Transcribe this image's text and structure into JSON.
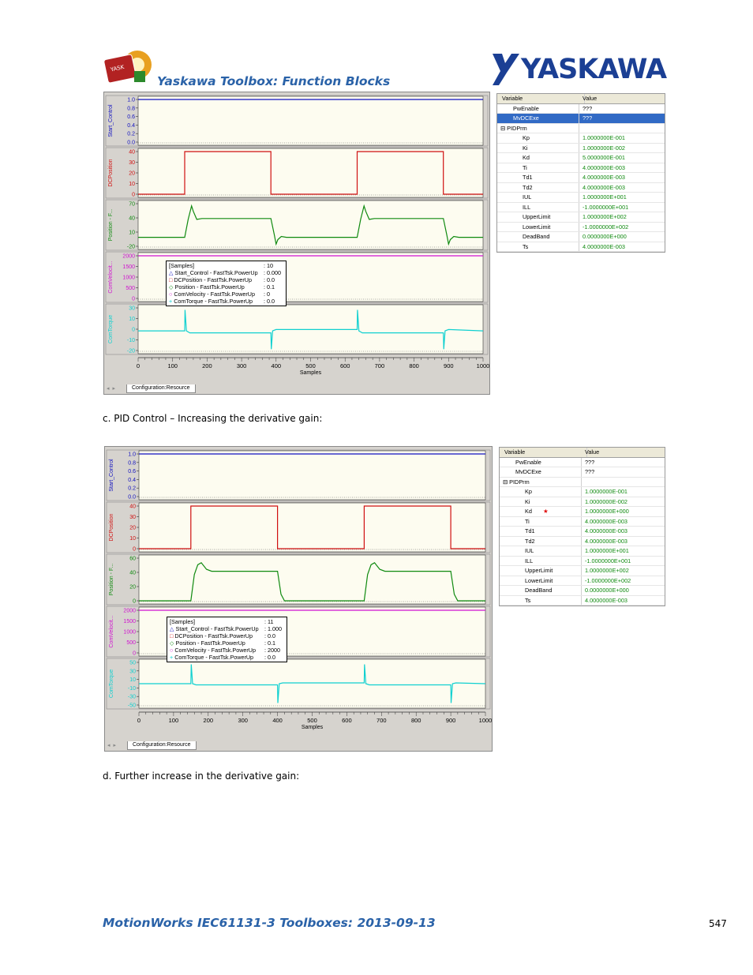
{
  "header": {
    "title": "Yaskawa Toolbox: Function Blocks",
    "brand": "YASKAWA",
    "logo_icon": "yaskawa-toolbox-logo"
  },
  "figures": [
    {
      "tab_label": "Configuration:Resource",
      "legend": {
        "title": "[Samples]",
        "title_value": ": 10",
        "rows": [
          {
            "label": "Start_Control - FastTsk.PowerUp",
            "value": ": 0.000",
            "color": "#1010c0",
            "marker": "triangle"
          },
          {
            "label": "DCPosition - FastTsk.PowerUp",
            "value": ": 0.0",
            "color": "#d01010",
            "marker": "square"
          },
          {
            "label": "Position - FastTsk.PowerUp",
            "value": ": 0.1",
            "color": "#108a10",
            "marker": "diamond"
          },
          {
            "label": "ComVelocity - FastTsk.PowerUp",
            "value": ": 0",
            "color": "#d010d0",
            "marker": "circle"
          },
          {
            "label": "ComTorque - FastTsk.PowerUp",
            "value": ": 0.0",
            "color": "#10d0d0",
            "marker": "plus"
          }
        ]
      },
      "variables": {
        "header": [
          "Variable",
          "Value"
        ],
        "rows": [
          {
            "name": "PwEnable",
            "value": "???",
            "indent": 1,
            "selected": false,
            "green": false
          },
          {
            "name": "MvDCExe",
            "value": "???",
            "indent": 1,
            "selected": true,
            "green": false
          },
          {
            "name": "PIDPrm",
            "value": "",
            "indent": 0,
            "expander": "⊟",
            "selected": false,
            "green": false
          },
          {
            "name": "Kp",
            "value": "1.0000000E-001",
            "indent": 2,
            "green": true
          },
          {
            "name": "Ki",
            "value": "1.0000000E-002",
            "indent": 2,
            "green": true
          },
          {
            "name": "Kd",
            "value": "5.0000000E-001",
            "indent": 2,
            "green": true
          },
          {
            "name": "Ti",
            "value": "4.0000000E-003",
            "indent": 2,
            "green": true
          },
          {
            "name": "Td1",
            "value": "4.0000000E-003",
            "indent": 2,
            "green": true
          },
          {
            "name": "Td2",
            "value": "4.0000000E-003",
            "indent": 2,
            "green": true
          },
          {
            "name": "IUL",
            "value": "1.0000000E+001",
            "indent": 2,
            "green": true
          },
          {
            "name": "ILL",
            "value": "-1.0000000E+001",
            "indent": 2,
            "green": true
          },
          {
            "name": "UpperLimit",
            "value": "1.0000000E+002",
            "indent": 2,
            "green": true
          },
          {
            "name": "LowerLimit",
            "value": "-1.0000000E+002",
            "indent": 2,
            "green": true
          },
          {
            "name": "DeadBand",
            "value": "0.0000000E+000",
            "indent": 2,
            "green": true
          },
          {
            "name": "Ts",
            "value": "4.0000000E-003",
            "indent": 2,
            "green": true
          }
        ]
      }
    },
    {
      "tab_label": "Configuration:Resource",
      "legend": {
        "title": "[Samples]",
        "title_value": ": 11",
        "rows": [
          {
            "label": "Start_Control - FastTsk.PowerUp",
            "value": ": 1.000",
            "color": "#1010c0",
            "marker": "triangle"
          },
          {
            "label": "DCPosition - FastTsk.PowerUp",
            "value": ": 0.0",
            "color": "#d01010",
            "marker": "square"
          },
          {
            "label": "Position - FastTsk.PowerUp",
            "value": ": 0.1",
            "color": "#108a10",
            "marker": "diamond"
          },
          {
            "label": "ComVelocity - FastTsk.PowerUp",
            "value": ": 2000",
            "color": "#d010d0",
            "marker": "circle"
          },
          {
            "label": "ComTorque - FastTsk.PowerUp",
            "value": ": 0.0",
            "color": "#10d0d0",
            "marker": "plus"
          }
        ]
      },
      "variables": {
        "header": [
          "Variable",
          "Value"
        ],
        "rows": [
          {
            "name": "PwEnable",
            "value": "???",
            "indent": 1,
            "selected": false,
            "green": false
          },
          {
            "name": "MvDCExe",
            "value": "???",
            "indent": 1,
            "selected": false,
            "green": false
          },
          {
            "name": "PIDPrm",
            "value": "",
            "indent": 0,
            "expander": "⊟",
            "selected": false,
            "green": false
          },
          {
            "name": "Kp",
            "value": "1.0000000E-001",
            "indent": 2,
            "green": true
          },
          {
            "name": "Ki",
            "value": "1.0000000E-002",
            "indent": 2,
            "green": true
          },
          {
            "name": "Kd",
            "value": "1.0000000E+000",
            "indent": 2,
            "green": true,
            "star": "★"
          },
          {
            "name": "Ti",
            "value": "4.0000000E-003",
            "indent": 2,
            "green": true
          },
          {
            "name": "Td1",
            "value": "4.0000000E-003",
            "indent": 2,
            "green": true
          },
          {
            "name": "Td2",
            "value": "4.0000000E-003",
            "indent": 2,
            "green": true
          },
          {
            "name": "IUL",
            "value": "1.0000000E+001",
            "indent": 2,
            "green": true
          },
          {
            "name": "ILL",
            "value": "-1.0000000E+001",
            "indent": 2,
            "green": true
          },
          {
            "name": "UpperLimit",
            "value": "1.0000000E+002",
            "indent": 2,
            "green": true
          },
          {
            "name": "LowerLimit",
            "value": "-1.0000000E+002",
            "indent": 2,
            "green": true
          },
          {
            "name": "DeadBand",
            "value": "0.0000000E+000",
            "indent": 2,
            "green": true
          },
          {
            "name": "Ts",
            "value": "4.0000000E-003",
            "indent": 2,
            "green": true
          }
        ]
      }
    }
  ],
  "chart_data": [
    {
      "type": "line",
      "xlabel": "Samples",
      "xlim": [
        0,
        1000
      ],
      "xticks": [
        0,
        100,
        200,
        300,
        400,
        500,
        600,
        700,
        800,
        900,
        1000
      ],
      "panels": [
        {
          "ylabel": "Start_Control",
          "color": "#1010c0",
          "yticks": [
            "1.0",
            "0.8",
            "0.6",
            "0.4",
            "0.2",
            "0.0"
          ],
          "ylim": [
            0,
            1
          ],
          "x": [
            0,
            1000
          ],
          "y": [
            1,
            1
          ]
        },
        {
          "ylabel": "DCPosition",
          "color": "#d01010",
          "yticks": [
            "40",
            "30",
            "20",
            "10",
            "0"
          ],
          "ylim": [
            0,
            45
          ],
          "x": [
            0,
            135,
            135,
            385,
            385,
            635,
            635,
            885,
            885,
            1000
          ],
          "y": [
            0,
            0,
            45,
            45,
            0,
            0,
            45,
            45,
            0,
            0
          ]
        },
        {
          "ylabel": "Position - F...",
          "color": "#108a10",
          "yticks": [
            "70",
            "40",
            "10",
            "-20"
          ],
          "ylim": [
            -20,
            75
          ],
          "x": [
            0,
            135,
            145,
            155,
            160,
            170,
            185,
            385,
            395,
            400,
            405,
            415,
            430,
            635,
            645,
            655,
            660,
            670,
            685,
            885,
            895,
            900,
            905,
            915,
            930,
            1000
          ],
          "y": [
            0,
            0,
            40,
            70,
            58,
            40,
            42,
            42,
            5,
            -15,
            -5,
            2,
            0,
            0,
            40,
            70,
            58,
            40,
            42,
            42,
            5,
            -15,
            -5,
            2,
            0,
            0
          ]
        },
        {
          "ylabel": "ComVelocit...",
          "color": "#d010d0",
          "yticks": [
            "2000",
            "1500",
            "1000",
            "500",
            "0"
          ],
          "ylim": [
            0,
            2000
          ],
          "x": [
            0,
            1000
          ],
          "y": [
            2000,
            2000
          ]
        },
        {
          "ylabel": "ComTorque",
          "color": "#10d0d0",
          "yticks": [
            "30",
            "10",
            "0",
            "-10",
            "-20"
          ],
          "ylim": [
            -30,
            35
          ],
          "x": [
            0,
            135,
            136,
            140,
            150,
            385,
            386,
            390,
            400,
            635,
            636,
            640,
            650,
            885,
            886,
            890,
            900,
            1000
          ],
          "y": [
            0,
            0,
            32,
            0,
            -3,
            -3,
            -28,
            0,
            2,
            2,
            32,
            0,
            -3,
            -3,
            -28,
            0,
            2,
            0
          ]
        }
      ]
    },
    {
      "type": "line",
      "xlabel": "Samples",
      "xlim": [
        0,
        1000
      ],
      "xticks": [
        0,
        100,
        200,
        300,
        400,
        500,
        600,
        700,
        800,
        900,
        1000
      ],
      "panels": [
        {
          "ylabel": "Start_Control",
          "color": "#1010c0",
          "yticks": [
            "1.0",
            "0.8",
            "0.6",
            "0.4",
            "0.2",
            "0.0"
          ],
          "ylim": [
            0,
            1
          ],
          "x": [
            0,
            1000
          ],
          "y": [
            1,
            1
          ]
        },
        {
          "ylabel": "DCPosition",
          "color": "#d01010",
          "yticks": [
            "40",
            "30",
            "20",
            "10",
            "0"
          ],
          "ylim": [
            0,
            45
          ],
          "x": [
            0,
            150,
            150,
            400,
            400,
            650,
            650,
            900,
            900,
            1000
          ],
          "y": [
            0,
            0,
            45,
            45,
            0,
            0,
            45,
            45,
            0,
            0
          ]
        },
        {
          "ylabel": "Position - F...",
          "color": "#108a10",
          "yticks": [
            "60",
            "40",
            "20",
            "0"
          ],
          "ylim": [
            0,
            65
          ],
          "x": [
            0,
            150,
            160,
            170,
            180,
            195,
            210,
            400,
            410,
            420,
            430,
            650,
            660,
            670,
            680,
            695,
            710,
            900,
            910,
            920,
            930,
            1000
          ],
          "y": [
            0,
            0,
            40,
            55,
            58,
            48,
            45,
            45,
            10,
            0,
            0,
            0,
            40,
            55,
            58,
            48,
            45,
            45,
            10,
            0,
            0,
            0
          ]
        },
        {
          "ylabel": "ComVelocit...",
          "color": "#d010d0",
          "yticks": [
            "2000",
            "1500",
            "1000",
            "500",
            "0"
          ],
          "ylim": [
            0,
            2000
          ],
          "x": [
            0,
            1000
          ],
          "y": [
            2000,
            2000
          ]
        },
        {
          "ylabel": "ComTorque",
          "color": "#10d0d0",
          "yticks": [
            "50",
            "30",
            "10",
            "-10",
            "-30",
            "-50"
          ],
          "ylim": [
            -55,
            55
          ],
          "x": [
            0,
            150,
            151,
            155,
            165,
            400,
            401,
            405,
            415,
            650,
            651,
            655,
            665,
            900,
            901,
            905,
            915,
            1000
          ],
          "y": [
            0,
            0,
            50,
            0,
            -3,
            -3,
            -50,
            0,
            2,
            2,
            50,
            0,
            -3,
            -3,
            -50,
            0,
            2,
            0
          ]
        }
      ]
    }
  ],
  "captions": {
    "c": "c.  PID Control – Increasing the derivative gain:",
    "d": "d.  Further increase in the derivative gain:"
  },
  "footer": {
    "title": "MotionWorks IEC61131-3 Toolboxes: 2013-09-13",
    "page": "547"
  }
}
